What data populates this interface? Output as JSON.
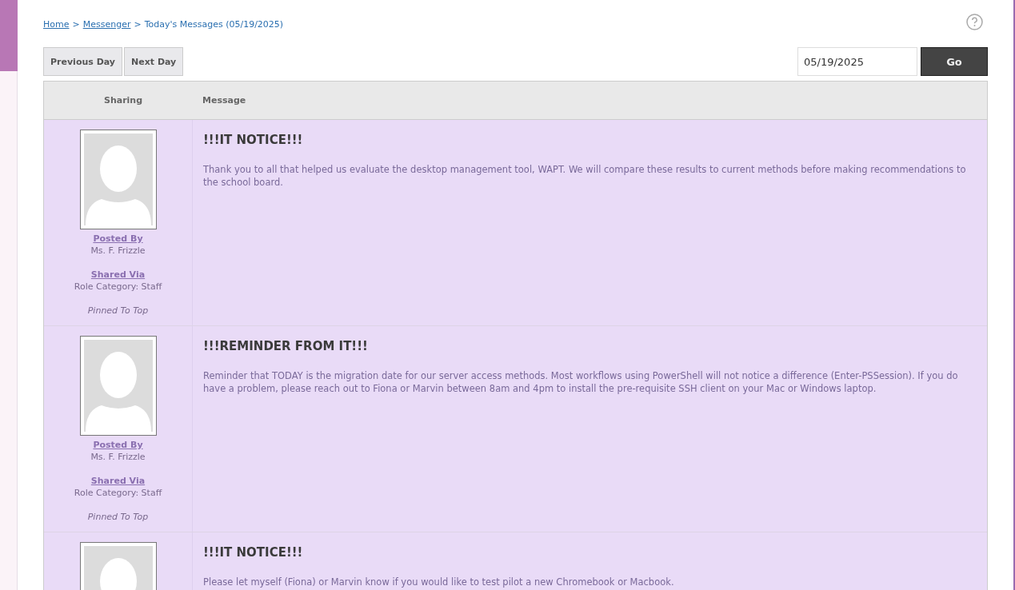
{
  "breadcrumb": {
    "links": [
      "Home",
      "Messenger"
    ],
    "separator": ">",
    "current": "Today's Messages (05/19/2025)"
  },
  "nav_buttons": [
    "Previous Day",
    "Next Day"
  ],
  "date_field": {
    "value": "05/19/2025"
  },
  "go_button": "Go",
  "table": {
    "columns": [
      "Sharing",
      "Message"
    ],
    "rows": [
      {
        "posted_by_label": "Posted By",
        "author": "Ms. F. Frizzle",
        "shared_via_label": "Shared Via",
        "shared_via": "Role Category: Staff",
        "pinned": "Pinned To Top",
        "title": "!!!IT NOTICE!!!",
        "body": "Thank you to all that helped us evaluate the desktop management tool, WAPT. We will compare these results to current methods before making recommendations to the school board."
      },
      {
        "posted_by_label": "Posted By",
        "author": "Ms. F. Frizzle",
        "shared_via_label": "Shared Via",
        "shared_via": "Role Category: Staff",
        "pinned": "Pinned To Top",
        "title": "!!!REMINDER FROM IT!!!",
        "body": "Reminder that TODAY is the migration date for our server access methods. Most workflows using PowerShell will not notice a difference (Enter-PSSession). If you do have a problem, please reach out to Fiona or Marvin between 8am and 4pm to install the pre-requisite SSH client on your Mac or Windows laptop."
      },
      {
        "title": "!!!IT NOTICE!!!",
        "body": "Please let myself (Fiona) or Marvin know if you would like to test pilot a new Chromebook or Macbook."
      }
    ]
  }
}
